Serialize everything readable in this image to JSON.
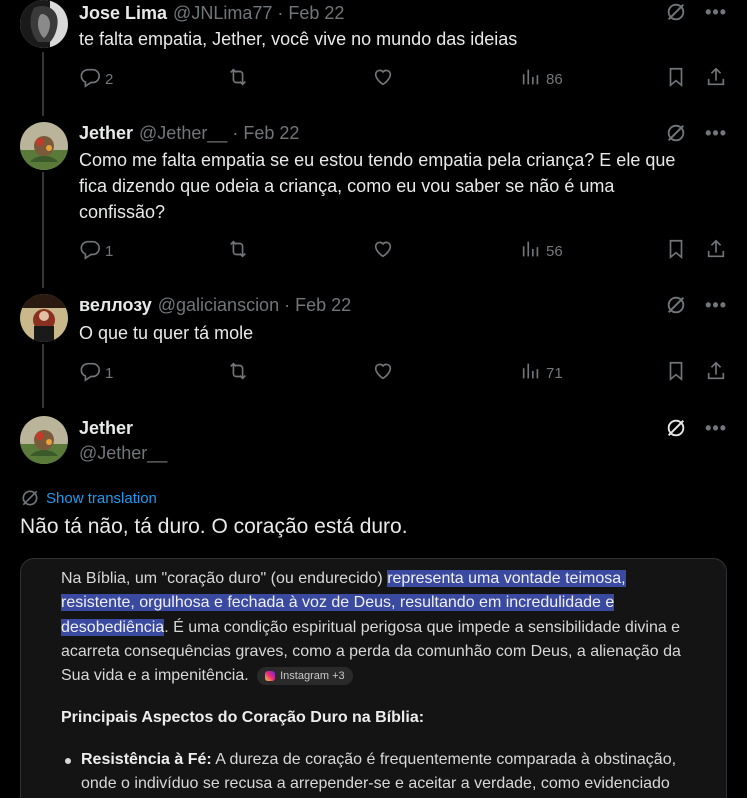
{
  "tweets": [
    {
      "display_name": "Jose Lima",
      "handle": "@JNLima77",
      "separator": "·",
      "date": "Feb 22",
      "text": "te falta empatia, Jether, você vive no mundo das ideias",
      "replies": "2",
      "retweets": "",
      "likes": "",
      "views": "86"
    },
    {
      "display_name": "Jether",
      "handle": "@Jether__",
      "separator": "·",
      "date": "Feb 22",
      "text_lines": [
        "Como me falta empatia se eu estou tendo empatia pela criança? E ele que",
        "fica dizendo que odeia a criança, como eu vou saber se não é uma",
        "confissão?"
      ],
      "replies": "1",
      "retweets": "",
      "likes": "",
      "views": "56"
    },
    {
      "display_name": "веллозу",
      "handle": "@galicianscion",
      "separator": "·",
      "date": "Feb 22",
      "text": "O que tu quer tá mole",
      "replies": "1",
      "retweets": "",
      "likes": "",
      "views": "71"
    }
  ],
  "focus_tweet": {
    "display_name": "Jether",
    "handle": "@Jether__",
    "show_translation": "Show translation",
    "text": "Não tá não, tá duro. O coração está duro."
  },
  "embed": {
    "para_intro": "Na Bíblia, um \"coração duro\" (ou endurecido) ",
    "para_highlight_1": "representa uma vontade teimosa,",
    "para_highlight_2": "resistente, orgulhosa e fechada à voz de Deus, resultando em incredulidade e",
    "para_highlight_3": "desobediência",
    "para_rest_1": ". É uma condição espiritual perigosa que impede a sensibilidade divina e",
    "para_rest_2": "acarreta consequências graves, como a perda da comunhão com Deus, a alienação da",
    "para_rest_3": "Sua vida e a impenitência.",
    "chip_label": "Instagram +3",
    "heading": "Principais Aspectos do Coração Duro na Bíblia:",
    "bullet_label": "Resistência à Fé:",
    "bullet_text_1": " A dureza de coração é frequentemente comparada à obstinação,",
    "bullet_text_2": "onde o indivíduo se recusa a arrepender-se e aceitar a verdade, como evidenciado"
  },
  "icons": {
    "reply": "reply-icon",
    "retweet": "retweet-icon",
    "like": "heart-icon",
    "views": "views-icon",
    "bookmark": "bookmark-icon",
    "share": "share-icon",
    "grok": "grok-icon",
    "more": "more-icon"
  },
  "colors": {
    "background": "#000000",
    "text": "#e7e9ea",
    "muted": "#71767b",
    "link": "#1d9bf0",
    "thread_line": "#333639",
    "highlight": "#3b4aa1"
  }
}
